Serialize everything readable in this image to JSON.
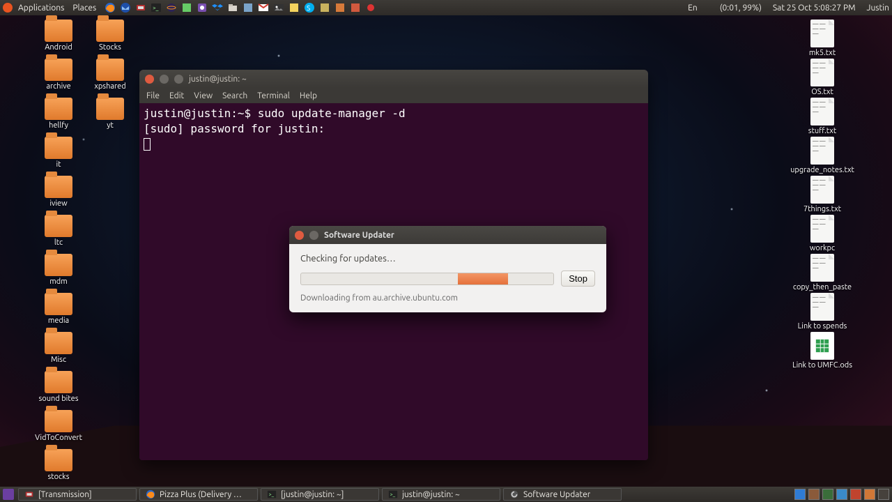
{
  "panel": {
    "menus": [
      "Applications",
      "Places"
    ],
    "indicators": {
      "lang": "En",
      "battery": "(0:01, 99%)",
      "clock": "Sat 25 Oct  5:08:27 PM",
      "user": "Justin"
    }
  },
  "desktop": {
    "left_col1": [
      "Android",
      "archive",
      "hellfy",
      "it",
      "iview",
      "ltc",
      "mdm",
      "media",
      "Misc",
      "sound bites",
      "VidToConvert",
      "stocks"
    ],
    "left_col2": [
      "Stocks",
      "xpshared",
      "yt"
    ],
    "right_files": [
      "mk5.txt",
      "OS.txt",
      "stuff.txt",
      "upgrade_notes.txt",
      "7things.txt",
      "workpc",
      "copy_then_paste",
      "Link to spends",
      "Link to UMFC.ods"
    ]
  },
  "terminal": {
    "title": "justin@justin: ~",
    "menubar": [
      "File",
      "Edit",
      "View",
      "Search",
      "Terminal",
      "Help"
    ],
    "line1_prompt": "justin@justin:~$ ",
    "line1_cmd": "sudo update-manager -d",
    "line2": "[sudo] password for justin:"
  },
  "updater": {
    "title": "Software Updater",
    "heading": "Checking for updates…",
    "stop": "Stop",
    "status": "Downloading from au.archive.ubuntu.com"
  },
  "taskbar": {
    "items": [
      {
        "icon": "transmission-icon",
        "label": "[Transmission]"
      },
      {
        "icon": "firefox-icon",
        "label": "Pizza Plus (Delivery …"
      },
      {
        "icon": "terminal-icon",
        "label": "[justin@justin: ~]"
      },
      {
        "icon": "terminal-icon",
        "label": "justin@justin: ~"
      },
      {
        "icon": "updater-icon",
        "label": "Software Updater"
      }
    ]
  }
}
